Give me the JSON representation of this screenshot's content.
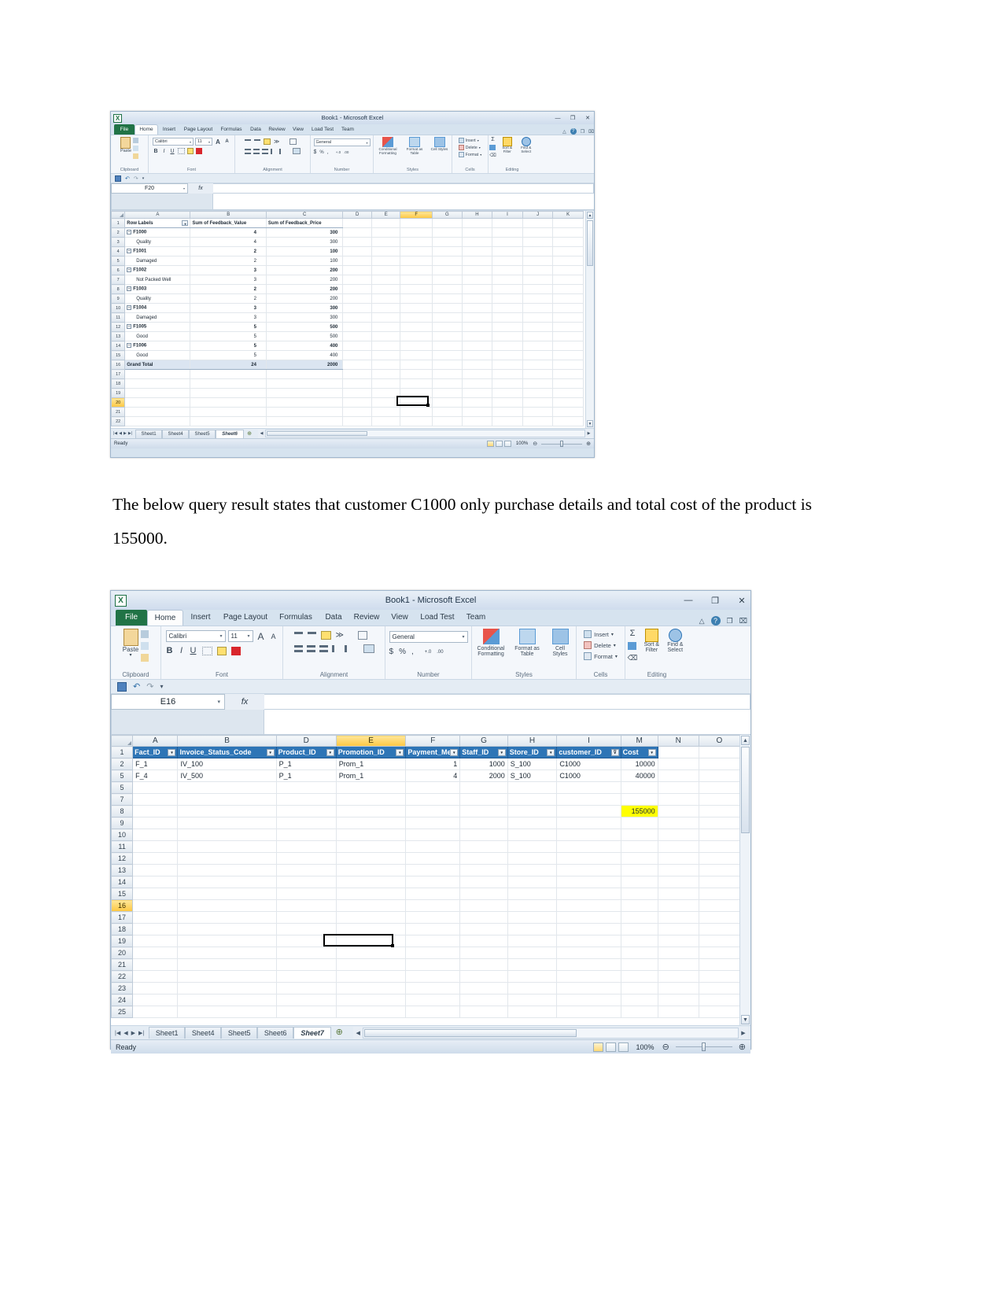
{
  "document": {
    "paragraph": "The below query result states that customer C1000 only purchase details and total cost of the product is 155000."
  },
  "window1": {
    "title": "Book1  -  Microsoft Excel",
    "logo_icon": "excel-logo-icon",
    "window_buttons": {
      "minimize": "—",
      "restore": "❐",
      "close": "✕"
    },
    "help_buttons": {
      "minimize_ribbon": "△",
      "help": "?",
      "restore_win": "❐",
      "close_win": "⌧"
    },
    "tabs": [
      "File",
      "Home",
      "Insert",
      "Page Layout",
      "Formulas",
      "Data",
      "Review",
      "View",
      "Load Test",
      "Team"
    ],
    "active_tab": "Home",
    "quick_access": {
      "save": "save-icon",
      "undo": "↶",
      "redo": "↷",
      "customize": "▾"
    },
    "ribbon": {
      "groups": [
        "Clipboard",
        "Font",
        "Alignment",
        "Number",
        "Styles",
        "Cells",
        "Editing"
      ],
      "paste_label": "Paste",
      "font_name": "Calibri",
      "font_size": "11",
      "grow_font": "A",
      "shrink_font": "A",
      "bold": "B",
      "italic": "I",
      "underline": "U",
      "number_format": "General",
      "currency": "$",
      "percent": "%",
      "comma": ",",
      "inc_dec": "+.0",
      "dec_dec": ".00",
      "conditional_formatting": "Conditional Formatting",
      "format_as_table": "Format as Table",
      "cell_styles": "Cell Styles",
      "insert": "Insert",
      "delete": "Delete",
      "format": "Format",
      "autosum": "Σ",
      "fill": "Fill",
      "clear": "Clear",
      "sort_filter": "Sort & Filter",
      "find_select": "Find & Select"
    },
    "name_box": "F20",
    "formula_bar": "",
    "fx_label": "fx",
    "columns": [
      "A",
      "B",
      "C",
      "D",
      "E",
      "F",
      "G",
      "H",
      "I",
      "J",
      "K"
    ],
    "selected_column": "F",
    "selected_row": "20",
    "row_numbers": [
      "1",
      "2",
      "3",
      "4",
      "5",
      "6",
      "7",
      "8",
      "9",
      "10",
      "11",
      "12",
      "13",
      "14",
      "15",
      "16",
      "17",
      "18",
      "19",
      "20",
      "21",
      "22"
    ],
    "pivot": {
      "headers": [
        "Row Labels",
        "Sum of Feedback_Value",
        "Sum of Feedback_Price"
      ],
      "rows": [
        {
          "row": "2",
          "label": "F1000",
          "group": true,
          "value": "4",
          "price": "300"
        },
        {
          "row": "3",
          "label": "Quality",
          "group": false,
          "value": "4",
          "price": "300"
        },
        {
          "row": "4",
          "label": "F1001",
          "group": true,
          "value": "2",
          "price": "100"
        },
        {
          "row": "5",
          "label": "Damaged",
          "group": false,
          "value": "2",
          "price": "100"
        },
        {
          "row": "6",
          "label": "F1002",
          "group": true,
          "value": "3",
          "price": "200"
        },
        {
          "row": "7",
          "label": "Not Packed Well",
          "group": false,
          "value": "3",
          "price": "200"
        },
        {
          "row": "8",
          "label": "F1003",
          "group": true,
          "value": "2",
          "price": "200"
        },
        {
          "row": "9",
          "label": "Quality",
          "group": false,
          "value": "2",
          "price": "200"
        },
        {
          "row": "10",
          "label": "F1004",
          "group": true,
          "value": "3",
          "price": "300"
        },
        {
          "row": "11",
          "label": "Damaged",
          "group": false,
          "value": "3",
          "price": "300"
        },
        {
          "row": "12",
          "label": "F1005",
          "group": true,
          "value": "5",
          "price": "500"
        },
        {
          "row": "13",
          "label": "Good",
          "group": false,
          "value": "5",
          "price": "500"
        },
        {
          "row": "14",
          "label": "F1006",
          "group": true,
          "value": "5",
          "price": "400"
        },
        {
          "row": "15",
          "label": "Good",
          "group": false,
          "value": "5",
          "price": "400"
        }
      ],
      "grand_total": {
        "row": "16",
        "label": "Grand Total",
        "value": "24",
        "price": "2000"
      }
    },
    "sheet_tabs": [
      "Sheet1",
      "Sheet4",
      "Sheet5",
      "Sheet6"
    ],
    "active_sheet": "Sheet6",
    "status_text": "Ready",
    "zoom_level": "100%"
  },
  "window2": {
    "title": "Book1  -  Microsoft Excel",
    "logo_icon": "excel-logo-icon",
    "window_buttons": {
      "minimize": "—",
      "restore": "❐",
      "close": "✕"
    },
    "help_buttons": {
      "minimize_ribbon": "△",
      "help": "?",
      "restore_win": "❐",
      "close_win": "⌧"
    },
    "tabs": [
      "File",
      "Home",
      "Insert",
      "Page Layout",
      "Formulas",
      "Data",
      "Review",
      "View",
      "Load Test",
      "Team"
    ],
    "active_tab": "Home",
    "quick_access": {
      "save": "save-icon",
      "undo": "↶",
      "redo": "↷",
      "customize": "▾"
    },
    "ribbon": {
      "groups": [
        "Clipboard",
        "Font",
        "Alignment",
        "Number",
        "Styles",
        "Cells",
        "Editing"
      ],
      "paste_label": "Paste",
      "font_name": "Calibri",
      "font_size": "11",
      "grow_font": "A",
      "shrink_font": "A",
      "bold": "B",
      "italic": "I",
      "underline": "U",
      "number_format": "General",
      "currency": "$",
      "percent": "%",
      "comma": ",",
      "inc_dec": "+.0",
      "dec_dec": ".00",
      "conditional_formatting": "Conditional Formatting",
      "format_as_table": "Format as Table",
      "cell_styles": "Cell Styles",
      "insert": "Insert",
      "delete": "Delete",
      "format": "Format",
      "autosum": "Σ",
      "fill": "Fill",
      "clear": "Clear",
      "sort_filter": "Sort & Filter",
      "find_select": "Find & Select"
    },
    "name_box": "E16",
    "formula_bar": "",
    "fx_label": "fx",
    "columns": [
      "A",
      "B",
      "D",
      "E",
      "F",
      "G",
      "H",
      "I",
      "M",
      "N",
      "O"
    ],
    "selected_column": "E",
    "selected_row": "16",
    "row_numbers": [
      "1",
      "2",
      "5",
      "7",
      "8",
      "9",
      "10",
      "11",
      "12",
      "13",
      "14",
      "15",
      "16",
      "17",
      "18",
      "19",
      "20",
      "21",
      "22",
      "23",
      "24",
      "25"
    ],
    "table": {
      "headers": [
        "Fact_ID",
        "Invoice_Status_Code",
        "Product_ID",
        "Promotion_ID",
        "Payment_Me",
        "Staff_ID",
        "Store_ID",
        "customer_ID",
        "Cost"
      ],
      "filter_icon": "filter-dropdown-icon",
      "filtered_column": "customer_ID",
      "rows": [
        {
          "row": "2",
          "Fact_ID": "F_1",
          "Invoice_Status_Code": "IV_100",
          "Product_ID": "P_1",
          "Promotion_ID": "Prom_1",
          "Payment_Me": "1",
          "Staff_ID": "1000",
          "Store_ID": "S_100",
          "customer_ID": "C1000",
          "Cost": "10000"
        },
        {
          "row": "5",
          "Fact_ID": "F_4",
          "Invoice_Status_Code": "IV_500",
          "Product_ID": "P_1",
          "Promotion_ID": "Prom_1",
          "Payment_Me": "4",
          "Staff_ID": "2000",
          "Store_ID": "S_100",
          "customer_ID": "C1000",
          "Cost": "40000"
        }
      ],
      "total_cell": {
        "row": "8",
        "column": "M",
        "value": "155000",
        "highlight": "#ffff00"
      }
    },
    "sheet_tabs": [
      "Sheet1",
      "Sheet4",
      "Sheet5",
      "Sheet6"
    ],
    "active_sheet": "Sheet7",
    "status_text": "Ready",
    "zoom_level": "100%"
  }
}
